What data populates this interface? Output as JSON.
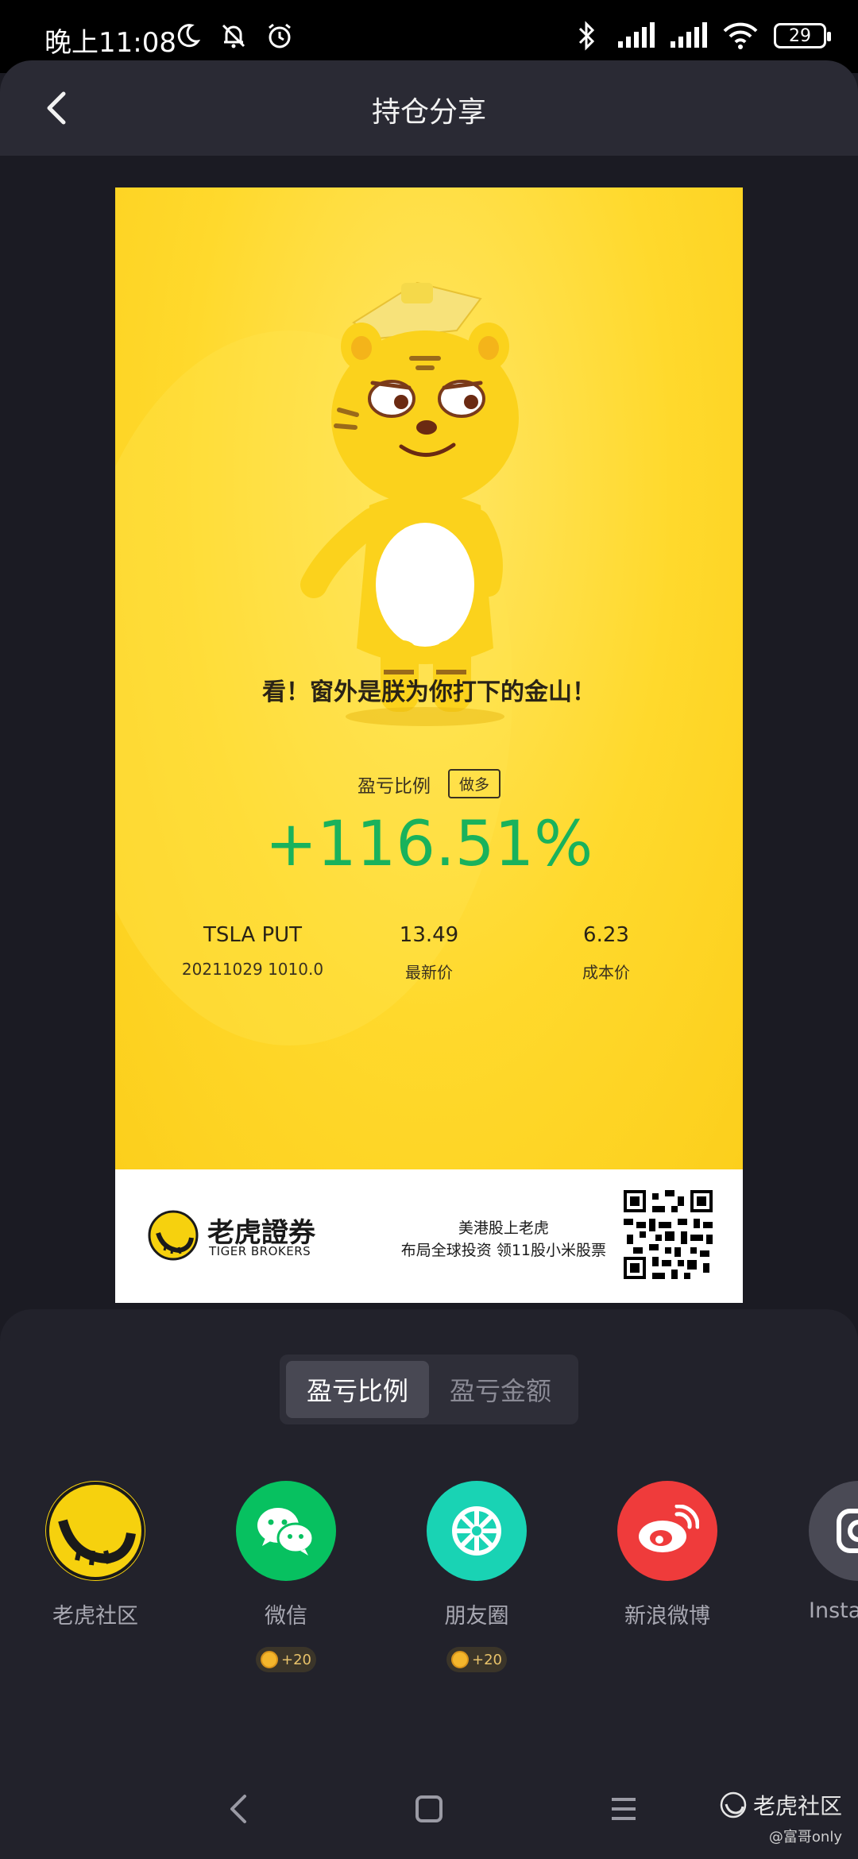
{
  "status_bar": {
    "time": "晚上11:08",
    "battery": "29"
  },
  "header": {
    "title": "持仓分享"
  },
  "card": {
    "headline": "看！窗外是朕为你打下的金山！",
    "pnl_label": "盈亏比例",
    "direction": "做多",
    "pnl_value": "+116.51%",
    "pnl_color": "#19b25c",
    "position": {
      "symbol": "TSLA PUT",
      "contract": "20211029 1010.0",
      "latest_price": "13.49",
      "latest_price_label": "最新价",
      "cost_price": "6.23",
      "cost_price_label": "成本价"
    },
    "footer": {
      "brand_name": "老虎證券",
      "brand_en": "TIGER BROKERS",
      "slogan_line1": "美港股上老虎",
      "slogan_line2": "布局全球投资 领11股小米股票"
    }
  },
  "sheet": {
    "tabs": [
      {
        "label": "盈亏比例",
        "active": true
      },
      {
        "label": "盈亏金额",
        "active": false
      }
    ],
    "targets": [
      {
        "label": "老虎社区",
        "icon": "tiger-community-icon",
        "color": "#f6d10e"
      },
      {
        "label": "微信",
        "icon": "wechat-icon",
        "color": "#07c160",
        "reward": "+20"
      },
      {
        "label": "朋友圈",
        "icon": "moments-icon",
        "color": "#19d3b4",
        "reward": "+20"
      },
      {
        "label": "新浪微博",
        "icon": "weibo-icon",
        "color": "#ef3b3b"
      },
      {
        "label": "Insta",
        "icon": "instagram-icon",
        "color": "#4a4a55"
      }
    ]
  },
  "watermark": {
    "main": "老虎社区",
    "sub": "@富哥only"
  }
}
